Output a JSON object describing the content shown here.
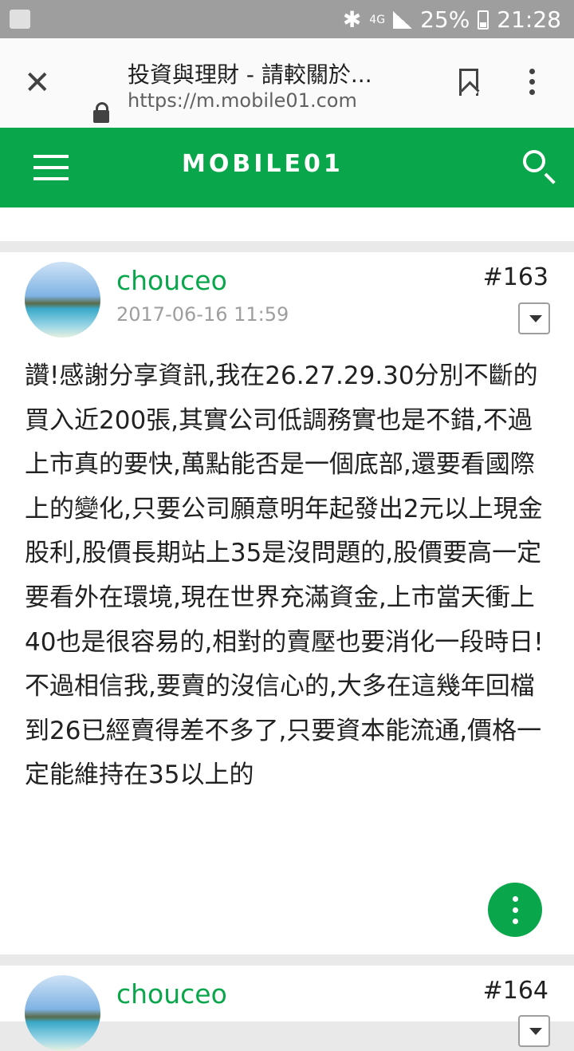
{
  "status_bar": {
    "network": "4G",
    "battery": "25%",
    "time": "21:28"
  },
  "browser": {
    "tab_title": "投資與理財 - 請較關於...",
    "url": "https://m.mobile01.com"
  },
  "site": {
    "logo_text": "MOBILE01",
    "accent_color": "#0aa64b"
  },
  "posts": [
    {
      "author": "chouceo",
      "date": "2017-06-16 11:59",
      "number": "#163",
      "body": "讚!感謝分享資訊,我在26.27.29.30分別不斷的買入近200張,其實公司低調務實也是不錯,不過上市真的要快,萬點能否是一個底部,還要看國際上的變化,只要公司願意明年起發出2元以上現金股利,股價長期站上35是沒問題的,股價要高一定要看外在環境,現在世界充滿資金,上市當天衝上40也是很容易的,相對的賣壓也要消化一段時日!不過相信我,要賣的沒信心的,大多在這幾年回檔到26已經賣得差不多了,只要資本能流通,價格一定能維持在35以上的"
    },
    {
      "author": "chouceo",
      "number": "#164"
    }
  ]
}
